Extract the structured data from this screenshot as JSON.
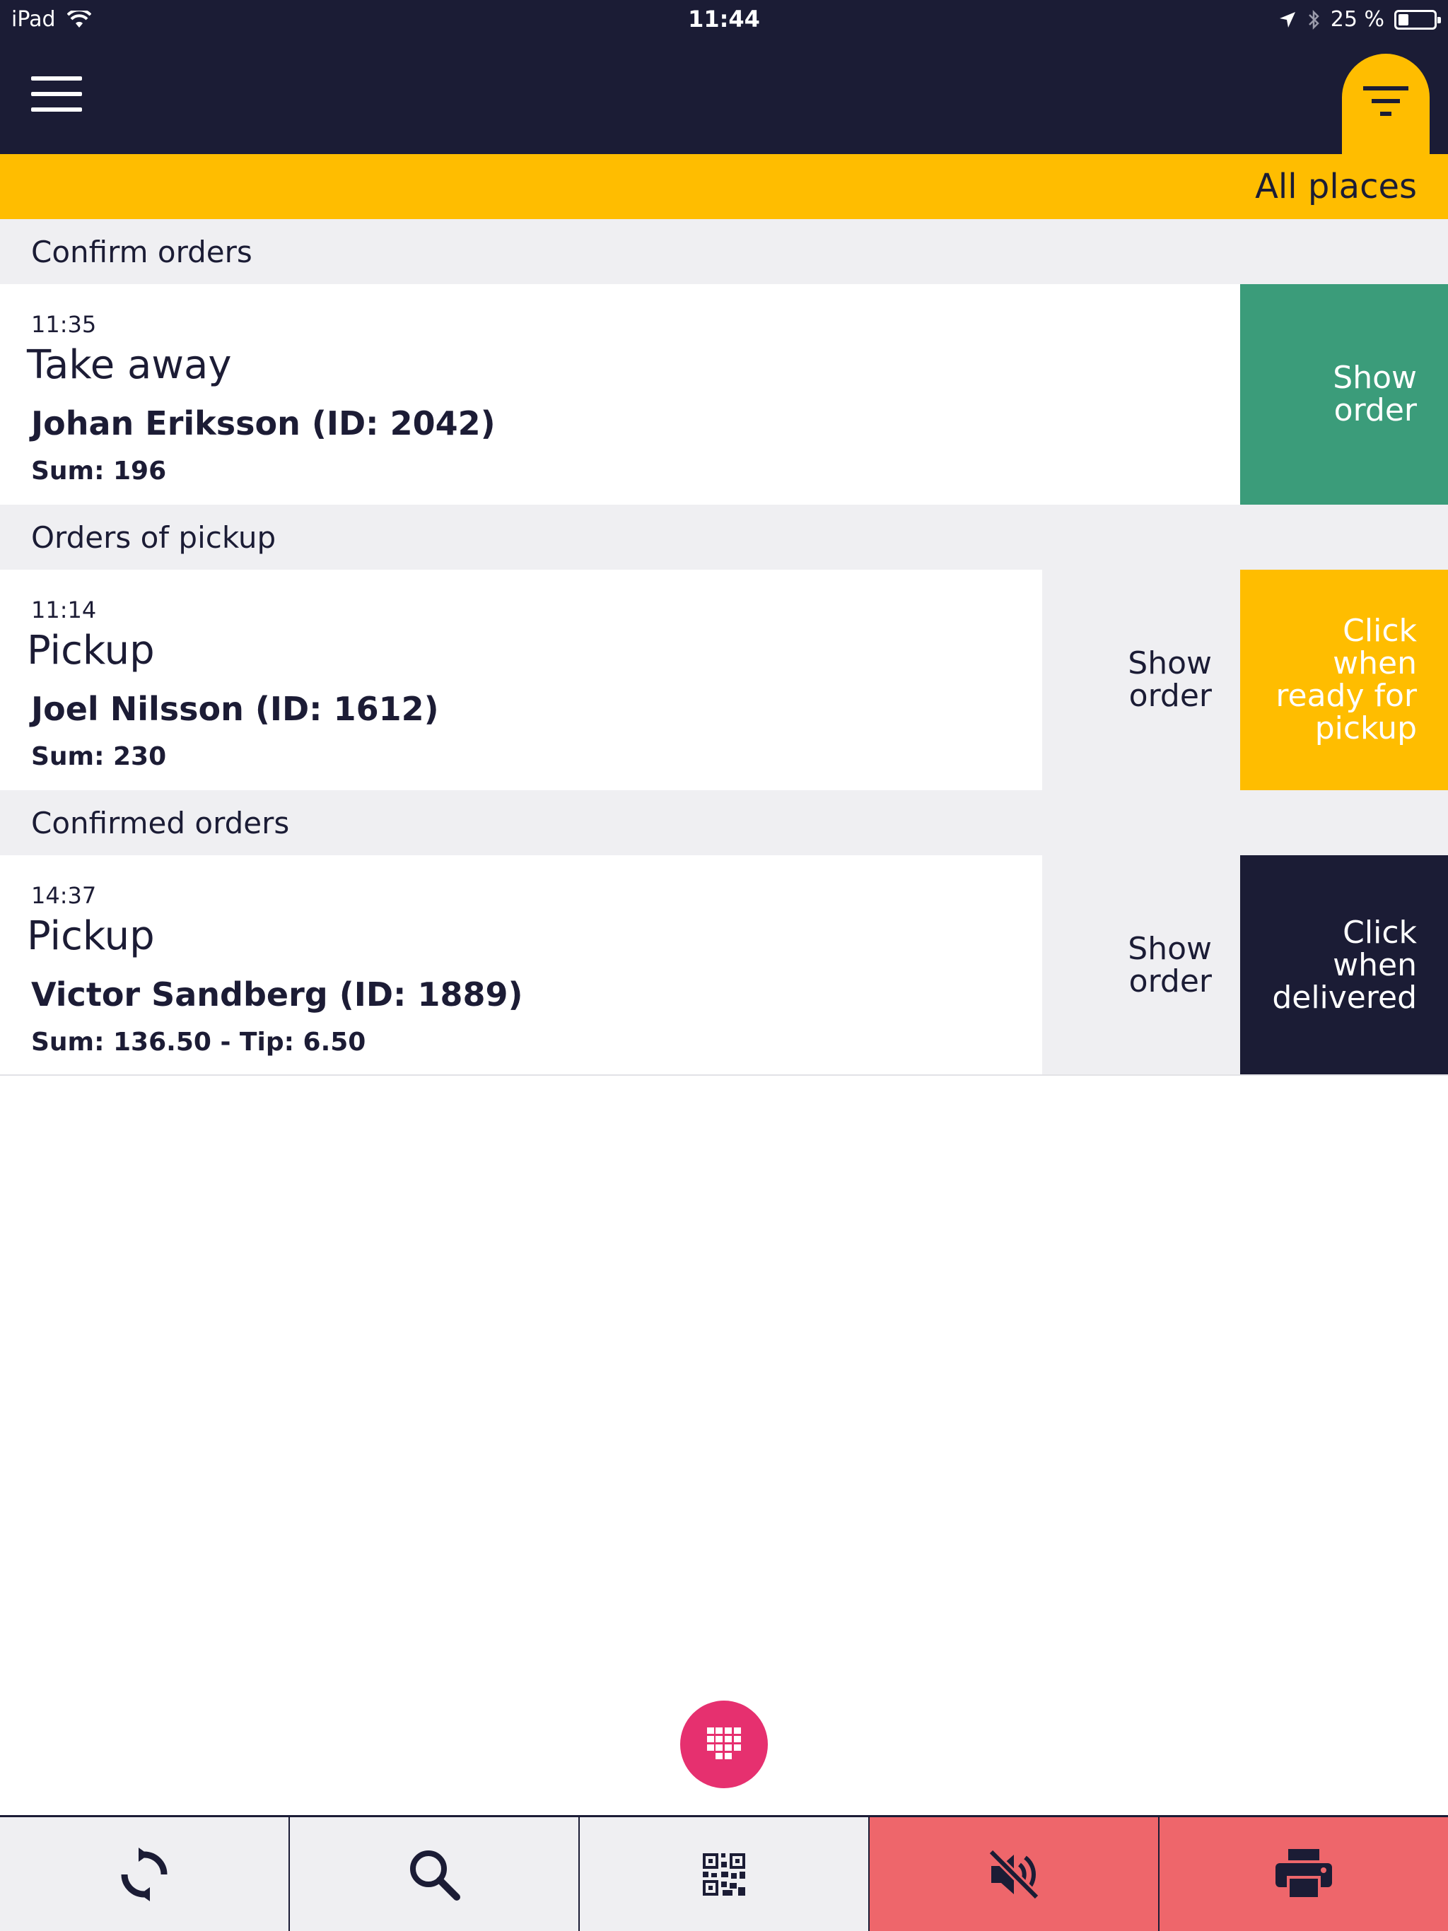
{
  "status_bar": {
    "device": "iPad",
    "time": "11:44",
    "battery": "25 %"
  },
  "header": {
    "filter_label": "All places"
  },
  "sections": {
    "confirm": "Confirm orders",
    "pickup": "Orders of pickup",
    "confirmed": "Confirmed orders"
  },
  "orders": [
    {
      "time": "11:35",
      "type": "Take away",
      "customer": "Johan Eriksson (ID: 2042)",
      "sum": "Sum: 196",
      "action_label": "Show\norder"
    },
    {
      "time": "11:14",
      "type": "Pickup",
      "customer": "Joel Nilsson (ID: 1612)",
      "sum": "Sum: 230",
      "show_label": "Show\norder",
      "action_label": "Click\nwhen\nready for\npickup"
    },
    {
      "time": "14:37",
      "type": "Pickup",
      "customer": "Victor Sandberg (ID: 1889)",
      "sum": "Sum: 136.50 - Tip: 6.50",
      "show_label": "Show\norder",
      "action_label": "Click\nwhen\ndelivered"
    }
  ],
  "colors": {
    "navy": "#1b1c35",
    "yellow": "#ffbd00",
    "green": "#3b9c7a",
    "pink": "#e6306f",
    "red": "#ee666b",
    "light_gray": "#efeff2"
  },
  "icons": {
    "menu": "hamburger-menu-icon",
    "filter": "filter-icon",
    "fab": "keypad-icon",
    "toolbar": [
      "refresh-icon",
      "search-icon",
      "qr-code-icon",
      "mute-icon",
      "printer-icon"
    ]
  }
}
